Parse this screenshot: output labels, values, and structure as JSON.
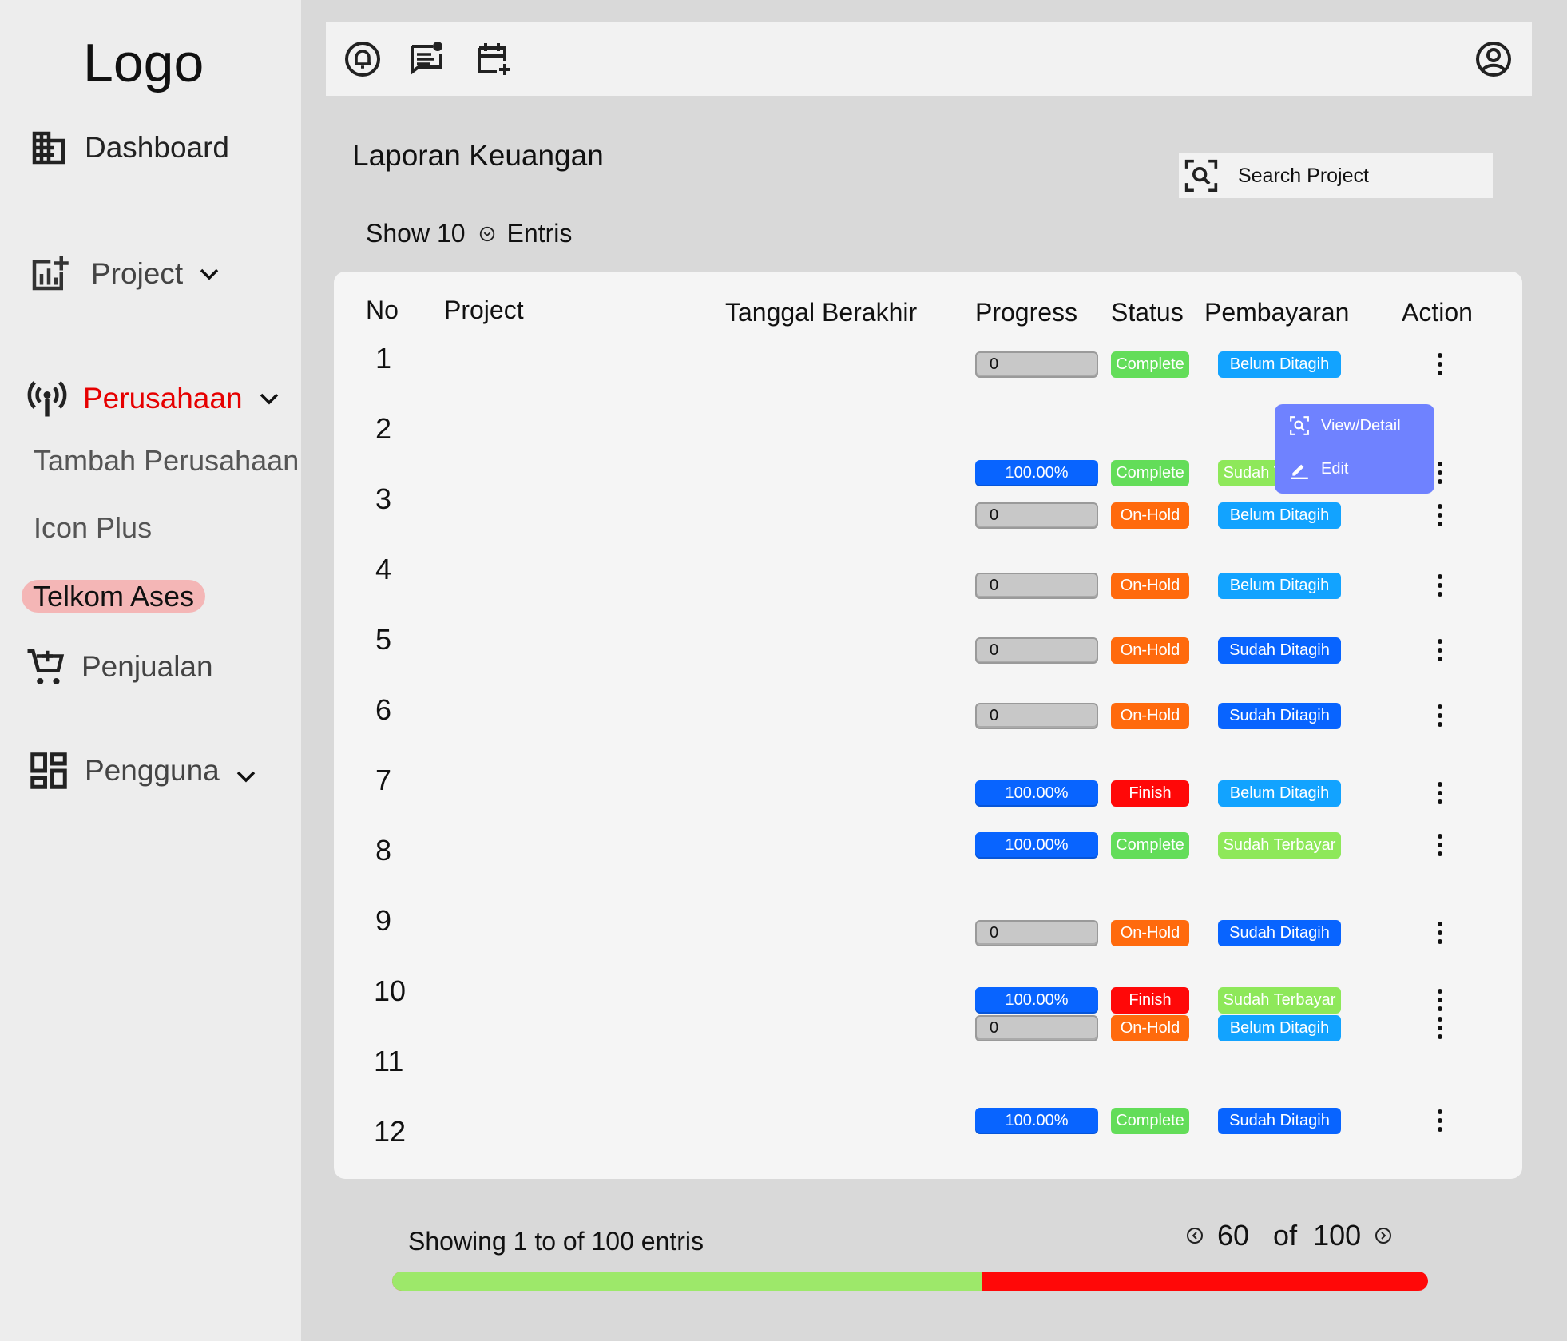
{
  "sidebar": {
    "logo": "Logo",
    "items": [
      {
        "label": "Dashboard",
        "icon": "building-icon"
      },
      {
        "label": "Project",
        "icon": "chart-add-icon"
      },
      {
        "label": "Perusahaan",
        "icon": "antenna-icon"
      },
      {
        "label": "Penjualan",
        "icon": "cart-add-icon"
      },
      {
        "label": "Pengguna",
        "icon": "dashboard-grid-icon"
      }
    ],
    "subitems": [
      "Tambah Perusahaan",
      "Icon Plus",
      "Telkom Ases"
    ],
    "active_color": "#e60000"
  },
  "topbar": {
    "icons": [
      "bell-icon",
      "message-icon",
      "calendar-add-icon",
      "user-circle-icon"
    ]
  },
  "main": {
    "title": "Laporan Keuangan",
    "search_placeholder": "Search Project",
    "show_label": "Show 10",
    "entries_label": "Entris"
  },
  "table": {
    "headers": [
      "No",
      "Project",
      "Tanggal Berakhir",
      "Progress",
      "Status",
      "Pembayaran",
      "Action"
    ],
    "rows": [
      {
        "no": "1",
        "progress": "0",
        "status": "Complete",
        "payment": "Belum Ditagih"
      },
      {
        "no": "2",
        "progress": "100.00%",
        "status": "Complete",
        "payment": "Sudah Terbayar"
      },
      {
        "no": "3",
        "progress": "0",
        "status": "On-Hold",
        "payment": "Belum Ditagih"
      },
      {
        "no": "4",
        "progress": "0",
        "status": "On-Hold",
        "payment": "Belum Ditagih"
      },
      {
        "no": "5",
        "progress": "0",
        "status": "On-Hold",
        "payment": "Sudah Ditagih"
      },
      {
        "no": "6",
        "progress": "0",
        "status": "On-Hold",
        "payment": "Sudah Ditagih"
      },
      {
        "no": "7",
        "progress": "100.00%",
        "status": "Finish",
        "payment": "Belum Ditagih"
      },
      {
        "no": "8",
        "progress": "100.00%",
        "status": "Complete",
        "payment": "Sudah Terbayar"
      },
      {
        "no": "9",
        "progress": "0",
        "status": "On-Hold",
        "payment": "Sudah Ditagih"
      },
      {
        "no": "10",
        "progress": "100.00%",
        "status": "Finish",
        "payment": "Sudah Terbayar"
      },
      {
        "no": "11",
        "progress": "0",
        "status": "On-Hold",
        "payment": "Belum Ditagih"
      },
      {
        "no": "12",
        "progress": "100.00%",
        "status": "Complete",
        "payment": "Sudah Ditagih"
      }
    ],
    "action_menu": {
      "view": "View/Detail",
      "edit": "Edit"
    }
  },
  "footer": {
    "showing": "Showing 1 to of 100 entris",
    "page_current": "60",
    "page_of": "of",
    "page_total": "100",
    "progress_fraction": 0.57
  }
}
